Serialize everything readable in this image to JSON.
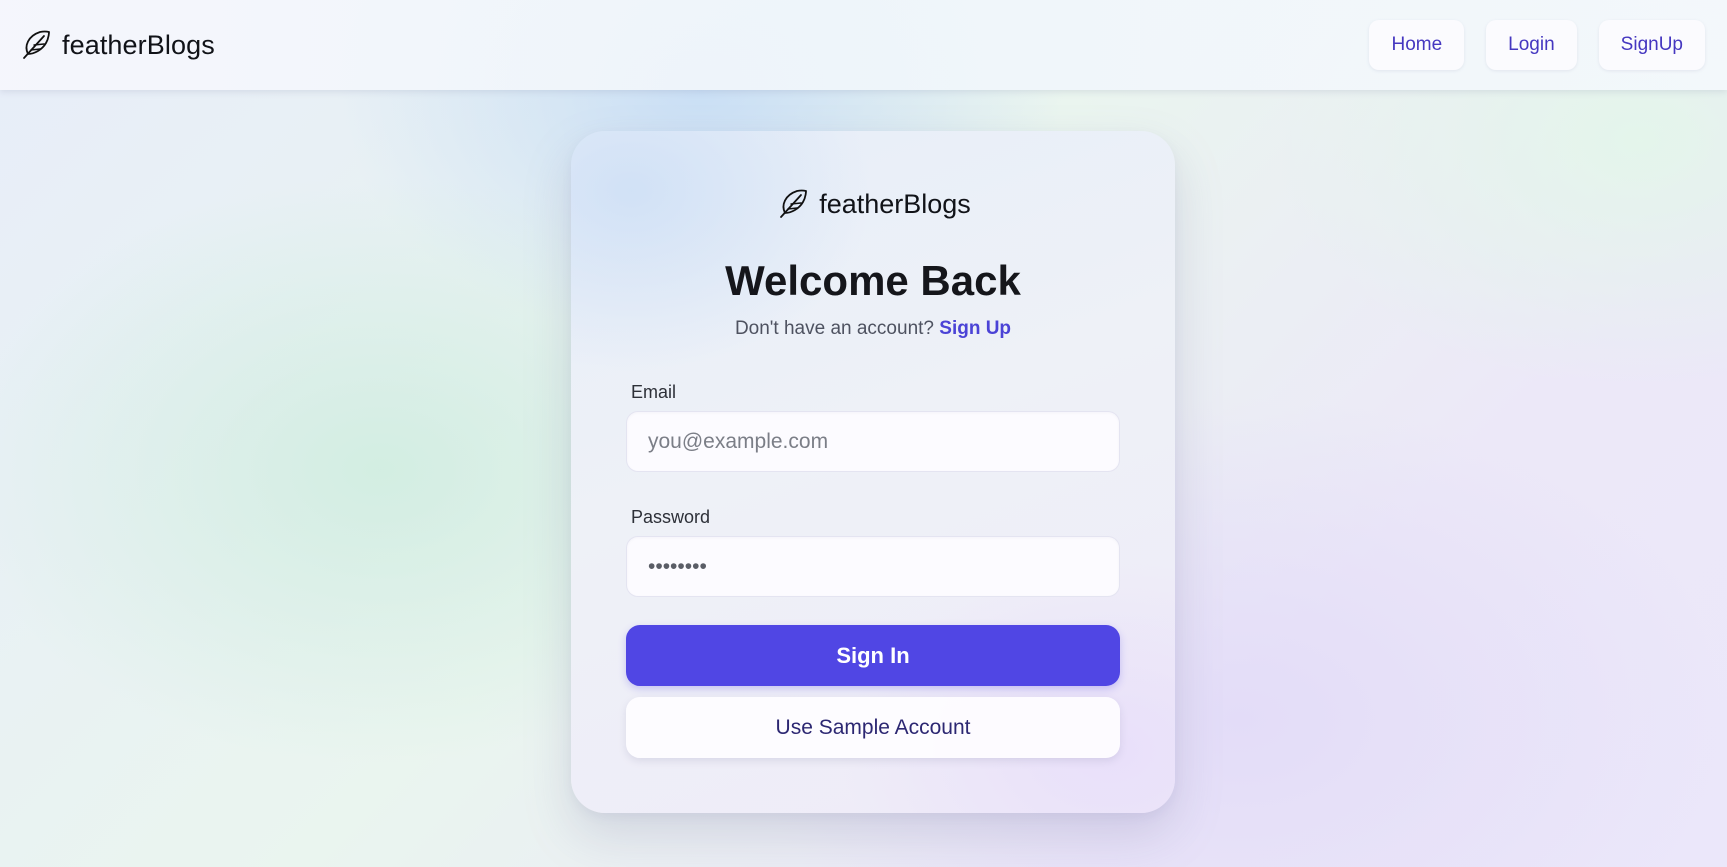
{
  "header": {
    "brand": "featherBlogs",
    "brand_icon": "feather-icon",
    "nav": [
      {
        "label": "Home"
      },
      {
        "label": "Login"
      },
      {
        "label": "SignUp"
      }
    ]
  },
  "card": {
    "brand": "featherBlogs",
    "title": "Welcome Back",
    "subtitle_prefix": "Don't have an account?",
    "subtitle_link": "Sign Up",
    "email": {
      "label": "Email",
      "placeholder": "you@example.com",
      "value": ""
    },
    "password": {
      "label": "Password",
      "value": "••••••••"
    },
    "sign_in_label": "Sign In",
    "sample_label": "Use Sample Account"
  },
  "colors": {
    "accent": "#5046e4",
    "link": "#4b43d6",
    "nav_text": "#4537c0"
  }
}
